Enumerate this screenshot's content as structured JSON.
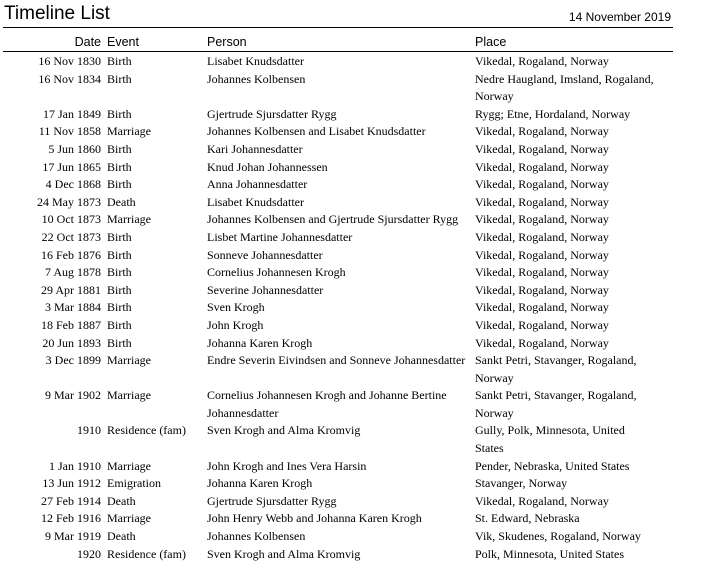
{
  "header": {
    "title": "Timeline List",
    "report_date": "14 November 2019"
  },
  "columns": {
    "date": "Date",
    "event": "Event",
    "person": "Person",
    "place": "Place"
  },
  "rows": [
    {
      "date": "16 Nov 1830",
      "event": "Birth",
      "person": "Lisabet Knudsdatter",
      "place": "Vikedal, Rogaland, Norway"
    },
    {
      "date": "16 Nov 1834",
      "event": "Birth",
      "person": "Johannes Kolbensen",
      "place": "Nedre Haugland, Imsland, Rogaland,  Norway"
    },
    {
      "date": "17 Jan 1849",
      "event": "Birth",
      "person": "Gjertrude Sjursdatter Rygg",
      "place": "Rygg; Etne, Hordaland, Norway"
    },
    {
      "date": "11 Nov 1858",
      "event": "Marriage",
      "person": "Johannes Kolbensen and Lisabet Knudsdatter",
      "place": "Vikedal, Rogaland, Norway"
    },
    {
      "date": "5 Jun 1860",
      "event": "Birth",
      "person": "Kari Johannesdatter",
      "place": "Vikedal, Rogaland, Norway"
    },
    {
      "date": "17 Jun 1865",
      "event": "Birth",
      "person": "Knud Johan Johannessen",
      "place": "Vikedal, Rogaland, Norway"
    },
    {
      "date": "4 Dec 1868",
      "event": "Birth",
      "person": "Anna Johannesdatter",
      "place": "Vikedal, Rogaland, Norway"
    },
    {
      "date": "24 May 1873",
      "event": "Death",
      "person": "Lisabet Knudsdatter",
      "place": "Vikedal, Rogaland, Norway"
    },
    {
      "date": "10 Oct 1873",
      "event": "Marriage",
      "person": "Johannes Kolbensen and Gjertrude Sjursdatter Rygg",
      "place": "Vikedal, Rogaland, Norway"
    },
    {
      "date": "22 Oct 1873",
      "event": "Birth",
      "person": "Lisbet Martine Johannesdatter",
      "place": "Vikedal, Rogaland, Norway"
    },
    {
      "date": "16 Feb 1876",
      "event": "Birth",
      "person": "Sonneve Johannesdatter",
      "place": "Vikedal, Rogaland, Norway"
    },
    {
      "date": "7 Aug 1878",
      "event": "Birth",
      "person": "Cornelius Johannesen Krogh",
      "place": "Vikedal, Rogaland, Norway"
    },
    {
      "date": "29 Apr 1881",
      "event": "Birth",
      "person": "Severine Johannesdatter",
      "place": "Vikedal, Rogaland, Norway"
    },
    {
      "date": "3 Mar 1884",
      "event": "Birth",
      "person": "Sven Krogh",
      "place": "Vikedal, Rogaland, Norway"
    },
    {
      "date": "18 Feb 1887",
      "event": "Birth",
      "person": "John Krogh",
      "place": "Vikedal, Rogaland, Norway"
    },
    {
      "date": "20 Jun 1893",
      "event": "Birth",
      "person": "Johanna Karen Krogh",
      "place": "Vikedal, Rogaland, Norway"
    },
    {
      "date": "3 Dec 1899",
      "event": "Marriage",
      "person": "Endre Severin Eivindsen and Sonneve Johannesdatter",
      "place": "Sankt Petri, Stavanger, Rogaland, Norway"
    },
    {
      "date": "9 Mar 1902",
      "event": "Marriage",
      "person": "Cornelius Johannesen Krogh and Johanne Bertine Johannesdatter",
      "place": "Sankt Petri, Stavanger, Rogaland, Norway"
    },
    {
      "date": "1910",
      "event": "Residence (fam)",
      "person": "Sven Krogh and Alma Kromvig",
      "place": "Gully, Polk, Minnesota, United States"
    },
    {
      "date": "1 Jan 1910",
      "event": "Marriage",
      "person": "John Krogh and Ines Vera Harsin",
      "place": "Pender, Nebraska, United States"
    },
    {
      "date": "13 Jun 1912",
      "event": "Emigration",
      "person": "Johanna Karen Krogh",
      "place": "Stavanger, Norway"
    },
    {
      "date": "27 Feb 1914",
      "event": "Death",
      "person": "Gjertrude Sjursdatter Rygg",
      "place": "Vikedal, Rogaland, Norway"
    },
    {
      "date": "12 Feb 1916",
      "event": "Marriage",
      "person": "John Henry Webb and Johanna Karen Krogh",
      "place": "St. Edward, Nebraska"
    },
    {
      "date": "9 Mar 1919",
      "event": "Death",
      "person": "Johannes Kolbensen",
      "place": "Vik, Skudenes, Rogaland, Norway"
    },
    {
      "date": "1920",
      "event": "Residence (fam)",
      "person": "Sven Krogh and Alma Kromvig",
      "place": "Polk, Minnesota, United States"
    }
  ]
}
